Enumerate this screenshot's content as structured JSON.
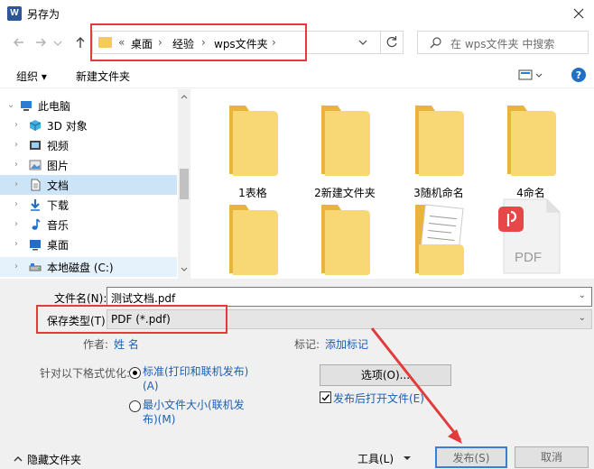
{
  "window": {
    "title": "另存为",
    "app_icon_letter": "W"
  },
  "address": {
    "prefix": "«",
    "crumbs": [
      "桌面",
      "经验",
      "wps文件夹"
    ]
  },
  "search": {
    "placeholder": "在 wps文件夹 中搜索"
  },
  "toolbar": {
    "organize": "组织 ▾",
    "new_folder": "新建文件夹"
  },
  "sidebar": {
    "items": [
      {
        "label": "此电脑",
        "icon": "computer-icon"
      },
      {
        "label": "3D 对象",
        "icon": "cube-3d-icon"
      },
      {
        "label": "视频",
        "icon": "video-icon"
      },
      {
        "label": "图片",
        "icon": "picture-icon"
      },
      {
        "label": "文档",
        "icon": "document-icon"
      },
      {
        "label": "下载",
        "icon": "download-icon"
      },
      {
        "label": "音乐",
        "icon": "music-icon"
      },
      {
        "label": "桌面",
        "icon": "desktop-icon"
      },
      {
        "label": "本地磁盘 (C:)",
        "icon": "drive-icon"
      }
    ]
  },
  "files": [
    {
      "name": "1表格",
      "type": "folder"
    },
    {
      "name": "2新建文件夹",
      "type": "folder"
    },
    {
      "name": "3随机命名",
      "type": "folder"
    },
    {
      "name": "4命名",
      "type": "folder"
    },
    {
      "name": "",
      "type": "folder"
    },
    {
      "name": "",
      "type": "folder"
    },
    {
      "name": "",
      "type": "folder-doc"
    },
    {
      "name": "",
      "type": "pdf",
      "badge": "PDF"
    }
  ],
  "form": {
    "filename_label": "文件名(N):",
    "filename_value": "测试文档.pdf",
    "filetype_label": "保存类型(T):",
    "filetype_value": "PDF (*.pdf)",
    "author_label": "作者:",
    "author_value": "姓 名",
    "tags_label": "标记:",
    "tags_value": "添加标记",
    "optimize_label": "针对以下格式优化:",
    "option1_line1": "标准(打印和联机发布)",
    "option1_line2": "(A)",
    "option2_line1": "最小文件大小(联机发",
    "option2_line2": "布)(M)",
    "options_button": "选项(O)...",
    "open_after_label": "发布后打开文件(E)"
  },
  "footer": {
    "hide_folders": "隐藏文件夹",
    "tools": "工具(L)",
    "publish": "发布(S)",
    "cancel": "取消"
  },
  "colors": {
    "accent": "#1a5fb4",
    "highlight": "#e23b3b",
    "folder": "#f5c95c"
  }
}
